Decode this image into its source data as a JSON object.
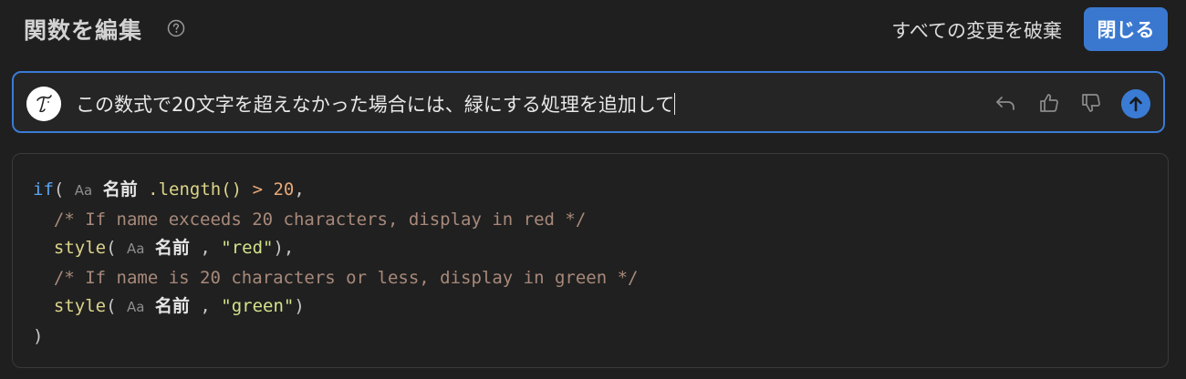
{
  "header": {
    "title": "関数を編集",
    "help_icon": "question-circle-icon",
    "discard_label": "すべての変更を破棄",
    "close_label": "閉じる"
  },
  "prompt": {
    "text": "この数式で20文字を超えなかった場合には、緑にする処理を追加して",
    "avatar_icon": "user-avatar-icon",
    "icons": [
      "undo-icon",
      "thumbs-up-icon",
      "thumbs-down-icon",
      "send-arrow-up-icon"
    ]
  },
  "code": {
    "line1": {
      "kw": "if",
      "open": "(",
      "prop_icon": "Aa",
      "prop_name": "名前",
      "method": ".length()",
      "op": ">",
      "num": "20",
      "tail": ","
    },
    "line2": "/* If name exceeds 20 characters, display in red */",
    "line3": {
      "fn": "style",
      "open": "(",
      "prop_icon": "Aa",
      "prop_name": "名前",
      "comma": ",",
      "str": "\"red\"",
      "tail": "),"
    },
    "line4": "/* If name is 20 characters or less, display in green */",
    "line5": {
      "fn": "style",
      "open": "(",
      "prop_icon": "Aa",
      "prop_name": "名前",
      "comma": ",",
      "str": "\"green\"",
      "tail": ")"
    },
    "line6": ")"
  },
  "colors": {
    "accent": "#3a7bd5",
    "background": "#1f1f1f",
    "keyword": "#5aa5f0",
    "function": "#dcd48a",
    "comment": "#a8897a",
    "string": "#d4e28c",
    "number": "#e8a878"
  }
}
